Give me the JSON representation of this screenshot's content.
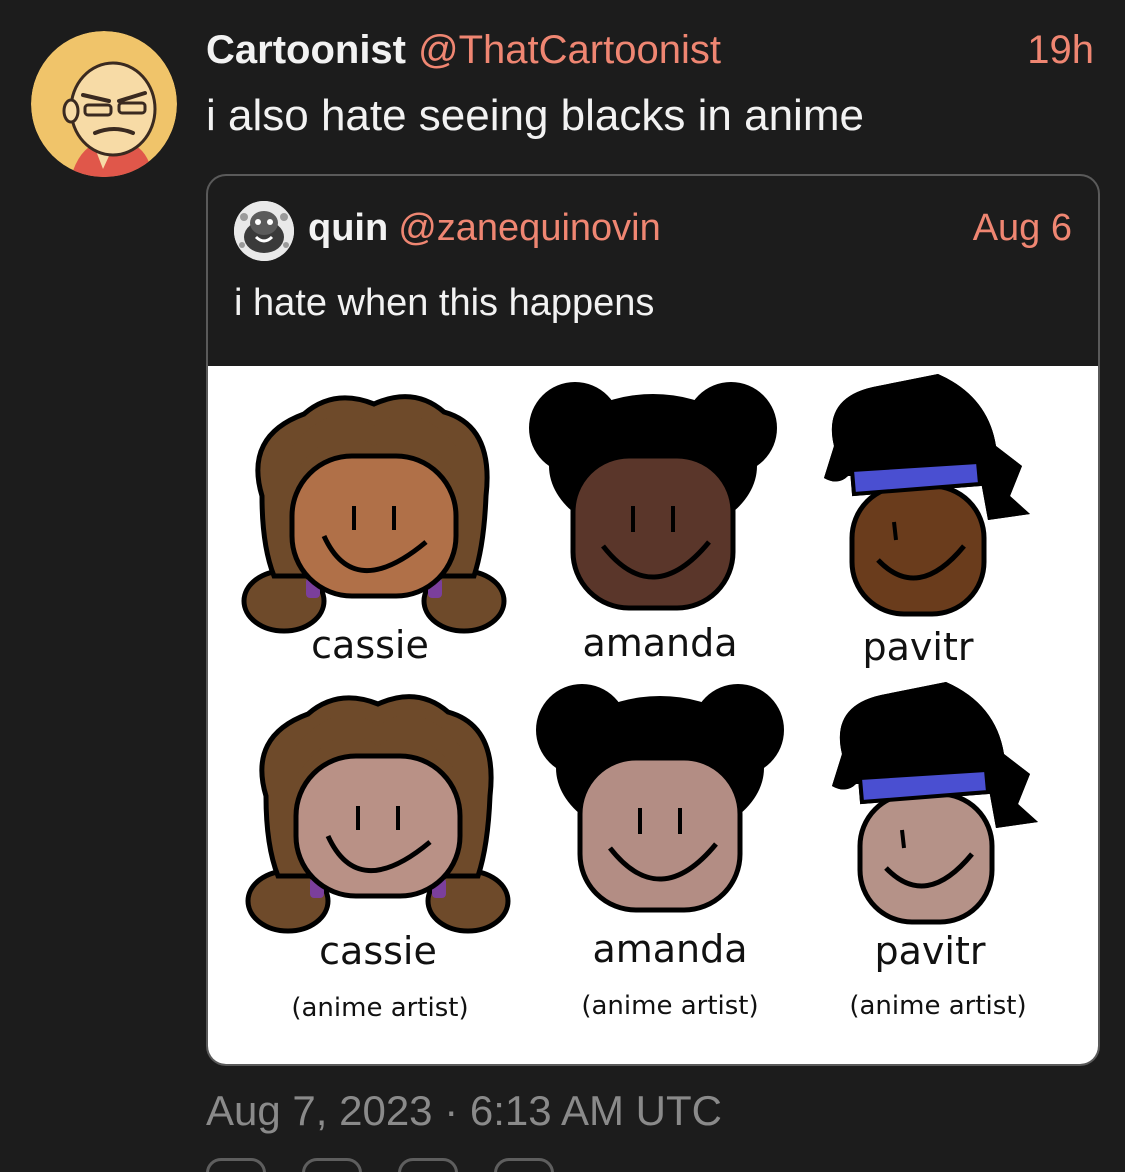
{
  "post": {
    "author_name": "Cartoonist",
    "author_handle": "@ThatCartoonist",
    "time": "19h",
    "text": "i also hate seeing blacks in anime",
    "timestamp": "Aug 7, 2023 · 6:13 AM UTC",
    "avatar_icon": "cartoon-grumpy-face-avatar"
  },
  "quote": {
    "author_name": "quin",
    "author_handle": "@zanequinovin",
    "time": "Aug 6",
    "text": "i hate when this happens",
    "avatar_icon": "mascot-avatar",
    "media": {
      "rows": [
        [
          "cassie",
          "amanda",
          "pavitr"
        ],
        [
          "cassie",
          "amanda",
          "pavitr"
        ]
      ],
      "row2_sublabel": "(anime artist)"
    }
  },
  "colors": {
    "background": "#1c1c1c",
    "text": "#f2f2f2",
    "accent": "#ef8672",
    "muted": "#8a8a8a",
    "border": "#5a5a5a"
  }
}
